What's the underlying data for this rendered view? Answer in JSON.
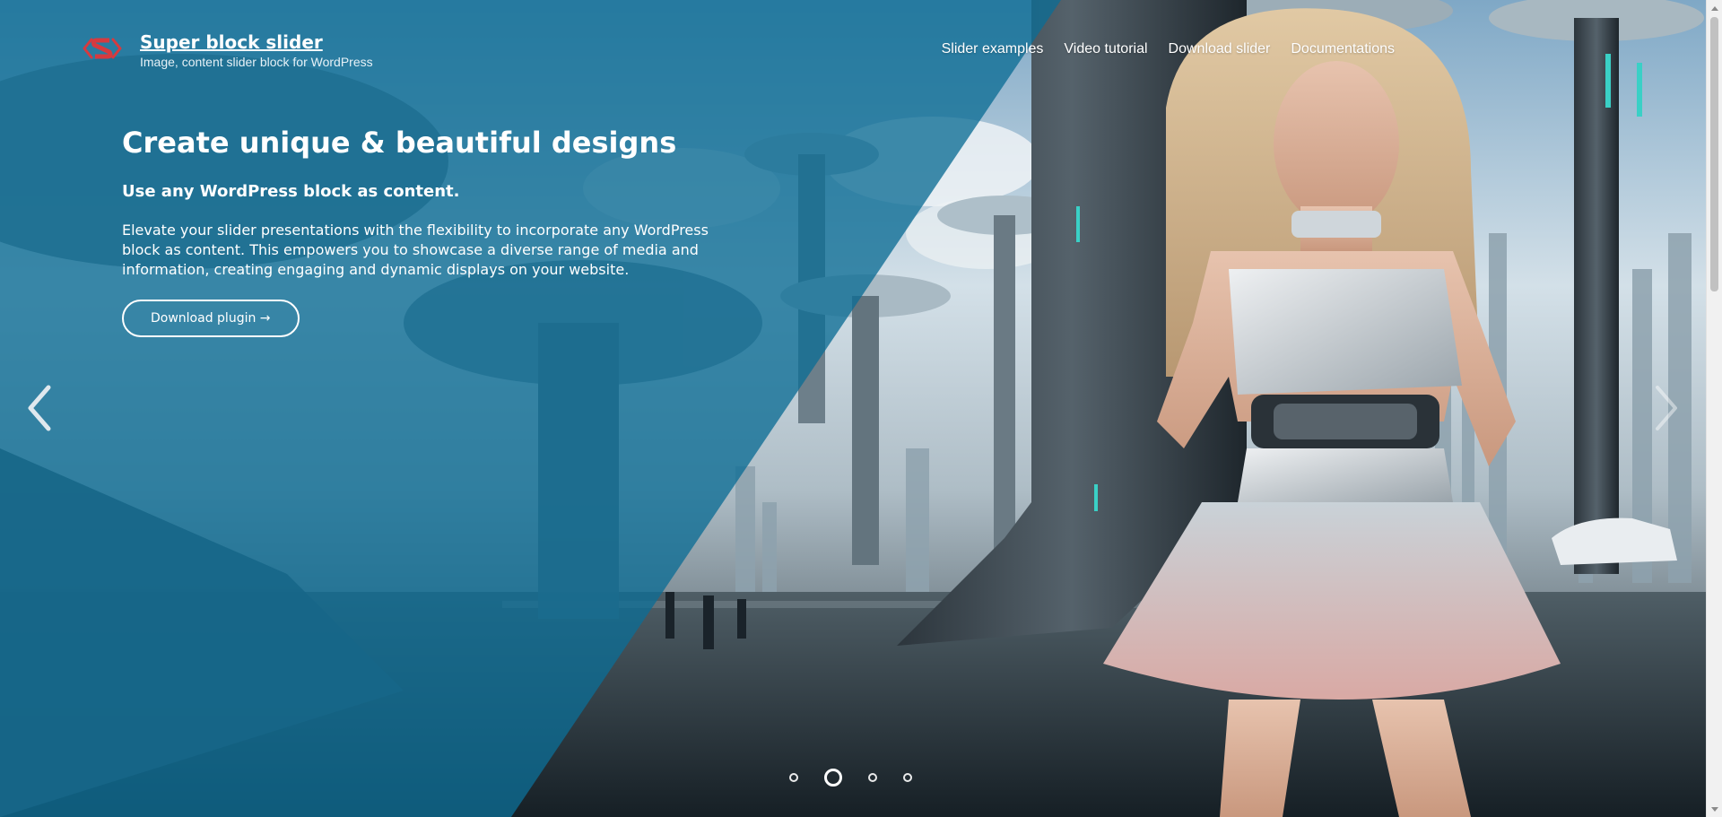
{
  "brand": {
    "title": "Super block slider",
    "tagline": "Image, content slider block for WordPress",
    "logo_icon": "super-block-slider-logo-icon",
    "logo_color": "#d63a3f"
  },
  "nav": {
    "items": [
      {
        "label": "Slider examples"
      },
      {
        "label": "Video tutorial"
      },
      {
        "label": "Download slider"
      },
      {
        "label": "Documentations"
      }
    ]
  },
  "hero": {
    "title": "Create unique & beautiful designs",
    "subtitle": "Use any WordPress block as content.",
    "body": "Elevate your slider presentations with the flexibility to incorporate any WordPress block as content. This empowers you to showcase a diverse range of media and information, creating engaging and dynamic displays on your website.",
    "button_label": "Download plugin →"
  },
  "slider": {
    "prev_icon": "chevron-left-icon",
    "next_icon": "chevron-right-icon",
    "slide_count": 4,
    "active_slide": 2
  },
  "colors": {
    "overlay_blue": "#0d6d95",
    "text": "#ffffff"
  }
}
